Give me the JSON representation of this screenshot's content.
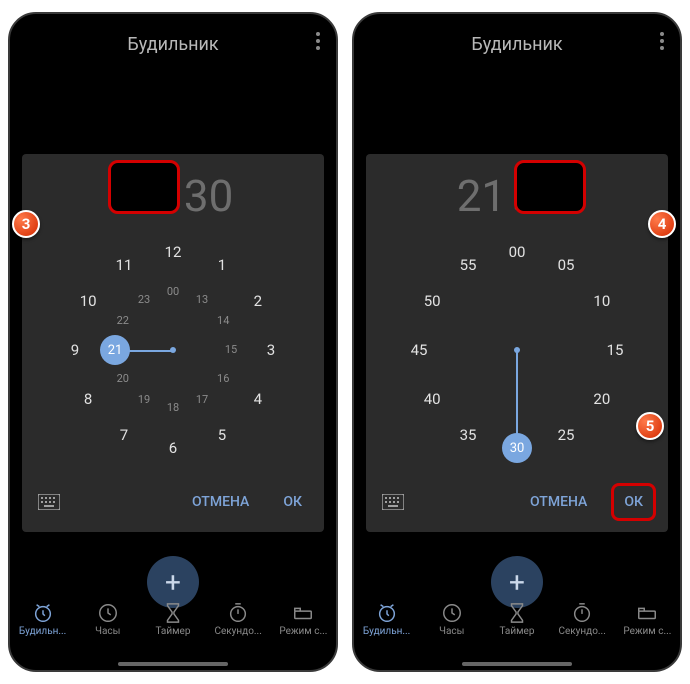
{
  "header": {
    "title": "Будильник"
  },
  "picker_left": {
    "hours": "21",
    "minutes": "30",
    "active": "hours",
    "outer": [
      "12",
      "1",
      "2",
      "3",
      "4",
      "5",
      "6",
      "7",
      "8",
      "9",
      "10",
      "11"
    ],
    "inner": [
      "00",
      "13",
      "14",
      "15",
      "16",
      "17",
      "18",
      "19",
      "20",
      "21",
      "22",
      "23"
    ],
    "selected_label": "21",
    "cancel": "ОТМЕНА",
    "ok": "ОК"
  },
  "picker_right": {
    "hours": "21",
    "minutes": "30",
    "active": "minutes",
    "outer": [
      "00",
      "05",
      "10",
      "15",
      "20",
      "25",
      "30",
      "35",
      "40",
      "45",
      "50",
      "55"
    ],
    "selected_label": "30",
    "cancel": "ОТМЕНА",
    "ok": "ОК"
  },
  "fab": {
    "label": "+"
  },
  "tabs": [
    {
      "label": "Будильн..."
    },
    {
      "label": "Часы"
    },
    {
      "label": "Таймер"
    },
    {
      "label": "Секундо..."
    },
    {
      "label": "Режим с..."
    }
  ],
  "badges": {
    "b3": "3",
    "b4": "4",
    "b5": "5"
  }
}
